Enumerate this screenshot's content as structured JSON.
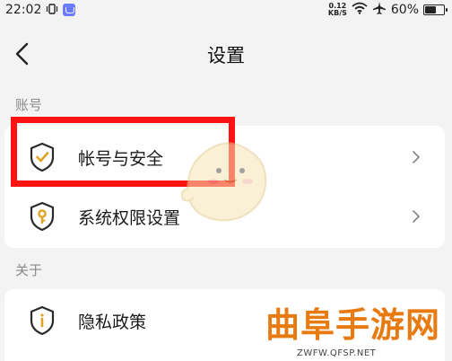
{
  "status_bar": {
    "time": "22:02",
    "net_speed_value": "0.12",
    "net_speed_unit": "KB/S",
    "battery_percent": "60%",
    "battery_level": 0.6
  },
  "header": {
    "title": "设置"
  },
  "sections": [
    {
      "label": "账号",
      "items": [
        {
          "label": "帐号与安全",
          "icon": "shield-check-icon"
        },
        {
          "label": "系统权限设置",
          "icon": "shield-key-icon"
        }
      ]
    },
    {
      "label": "关于",
      "items": [
        {
          "label": "隐私政策",
          "icon": "shield-info-icon"
        }
      ]
    }
  ],
  "watermark": {
    "text": "曲阜手游网",
    "url": "ZWFW.QFSP.NET"
  },
  "colors": {
    "background": "#f3f3f3",
    "card": "#ffffff",
    "icon_stroke": "#e0a020",
    "highlight": "#ff1212",
    "watermark": "#e87a12"
  }
}
